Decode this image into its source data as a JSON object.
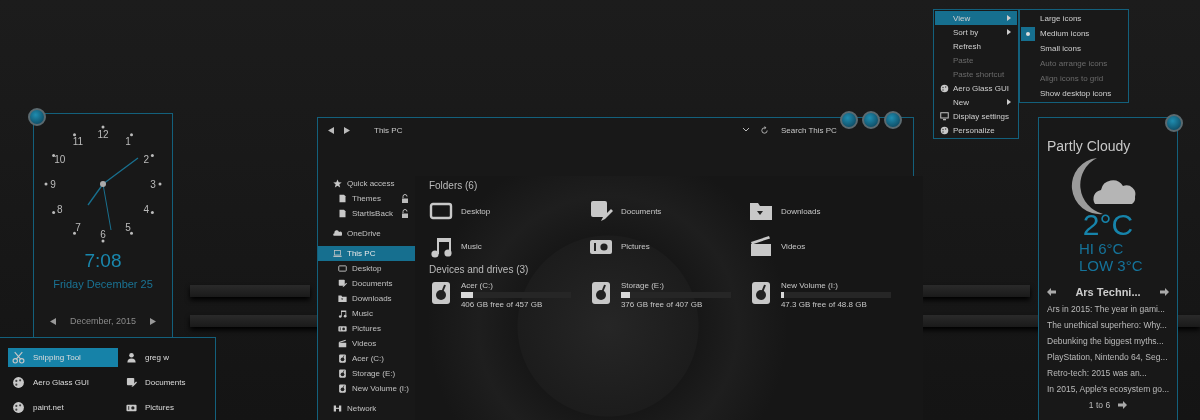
{
  "clock": {
    "numbers": [
      "12",
      "1",
      "2",
      "3",
      "4",
      "5",
      "6",
      "7",
      "8",
      "9",
      "10",
      "11"
    ],
    "time": "7:08",
    "date": "Friday December 25",
    "month": "December, 2015"
  },
  "explorer": {
    "path": "This PC",
    "search_placeholder": "Search This PC",
    "nav": [
      {
        "label": "Quick access",
        "kind": "star",
        "selected": false,
        "children": [
          {
            "label": "Themes",
            "kind": "file",
            "pinned": true,
            "selected": false
          },
          {
            "label": "StartIsBack",
            "kind": "file",
            "pinned": true,
            "selected": false
          }
        ]
      },
      {
        "label": "OneDrive",
        "kind": "cloud",
        "selected": false
      },
      {
        "label": "This PC",
        "kind": "pc",
        "selected": true,
        "children": [
          {
            "label": "Desktop",
            "kind": "desktop",
            "pinned": false,
            "selected": false
          },
          {
            "label": "Documents",
            "kind": "documents",
            "pinned": false,
            "selected": false
          },
          {
            "label": "Downloads",
            "kind": "downloads",
            "pinned": false,
            "selected": false
          },
          {
            "label": "Music",
            "kind": "music",
            "pinned": false,
            "selected": false
          },
          {
            "label": "Pictures",
            "kind": "pictures",
            "pinned": false,
            "selected": false
          },
          {
            "label": "Videos",
            "kind": "videos",
            "pinned": false,
            "selected": false
          },
          {
            "label": "Acer (C:)",
            "kind": "drive",
            "pinned": false,
            "selected": false
          },
          {
            "label": "Storage (E:)",
            "kind": "drive",
            "pinned": false,
            "selected": false
          },
          {
            "label": "New Volume (I:)",
            "kind": "drive",
            "pinned": false,
            "selected": false
          }
        ]
      },
      {
        "label": "Network",
        "kind": "network",
        "selected": false
      }
    ],
    "folders_heading": "Folders (6)",
    "folders": [
      {
        "label": "Desktop",
        "kind": "desktop"
      },
      {
        "label": "Documents",
        "kind": "documents"
      },
      {
        "label": "Downloads",
        "kind": "downloads"
      },
      {
        "label": "Music",
        "kind": "music"
      },
      {
        "label": "Pictures",
        "kind": "pictures"
      },
      {
        "label": "Videos",
        "kind": "videos"
      }
    ],
    "drives_heading": "Devices and drives (3)",
    "drives": [
      {
        "label": "Acer (C:)",
        "free": "406 GB free of 457 GB",
        "level": 0.11
      },
      {
        "label": "Storage (E:)",
        "free": "376 GB free of 407 GB",
        "level": 0.08
      },
      {
        "label": "New Volume (I:)",
        "free": "47.3 GB free of 48.8 GB",
        "level": 0.03
      }
    ]
  },
  "context_menu": {
    "items": [
      {
        "label": "View",
        "kind": "none",
        "submenu": true,
        "disabled": false,
        "selected": true
      },
      {
        "label": "Sort by",
        "kind": "none",
        "submenu": true,
        "disabled": false,
        "selected": false
      },
      {
        "label": "Refresh",
        "kind": "none",
        "submenu": false,
        "disabled": false,
        "selected": false
      },
      {
        "label": "Paste",
        "kind": "none",
        "submenu": false,
        "disabled": true,
        "selected": false
      },
      {
        "label": "Paste shortcut",
        "kind": "none",
        "submenu": false,
        "disabled": true,
        "selected": false
      },
      {
        "label": "Aero Glass GUI",
        "kind": "palette",
        "submenu": false,
        "disabled": false,
        "selected": false
      },
      {
        "label": "New",
        "kind": "none",
        "submenu": true,
        "disabled": false,
        "selected": false
      },
      {
        "label": "Display settings",
        "kind": "monitor",
        "submenu": false,
        "disabled": false,
        "selected": false
      },
      {
        "label": "Personalize",
        "kind": "palette",
        "submenu": false,
        "disabled": false,
        "selected": false
      }
    ],
    "submenu": [
      {
        "label": "Large icons",
        "checked": false,
        "disabled": false
      },
      {
        "label": "Medium icons",
        "checked": true,
        "disabled": false
      },
      {
        "label": "Small icons",
        "checked": false,
        "disabled": false
      },
      {
        "label": "Auto arrange icons",
        "checked": false,
        "disabled": true
      },
      {
        "label": "Align icons to grid",
        "checked": false,
        "disabled": true
      },
      {
        "label": "Show desktop icons",
        "checked": false,
        "disabled": false
      }
    ]
  },
  "weather": {
    "condition": "Partly Cloudy",
    "temp": "2°C",
    "hi": "HI  6°C",
    "low": "LOW 3°C",
    "feed_title": "Ars Techni...",
    "feed": [
      "Ars in 2015: The year in gami...",
      "The unethical superhero: Why...",
      "Debunking the biggest myths...",
      "PlayStation, Nintendo 64, Seg...",
      "Retro-tech: 2015 was an...",
      "In 2015, Apple's ecosystem go..."
    ],
    "pager": "1 to 6"
  },
  "start_menu": {
    "apps": [
      {
        "label": "Snipping Tool",
        "kind": "scissors",
        "selected": true
      },
      {
        "label": "Aero Glass GUI",
        "kind": "palette",
        "selected": false
      },
      {
        "label": "paint.net",
        "kind": "palette",
        "selected": false
      }
    ],
    "places": [
      {
        "label": "greg w",
        "kind": "user"
      },
      {
        "label": "Documents",
        "kind": "documents"
      },
      {
        "label": "Pictures",
        "kind": "pictures"
      }
    ]
  }
}
